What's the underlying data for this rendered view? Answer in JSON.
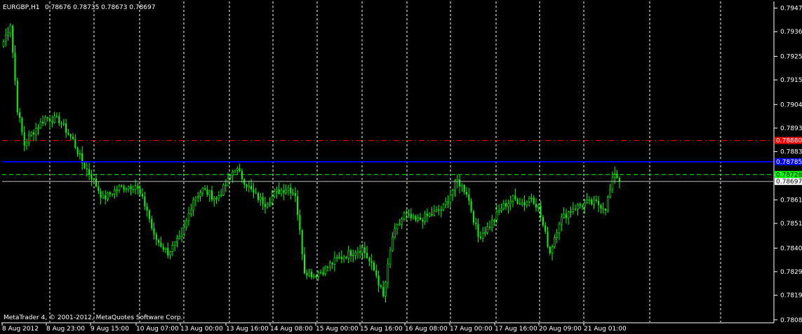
{
  "window": {
    "title": "EURGBP,H1",
    "ohlc": "0.78676 0.78735 0.78673 0.78697",
    "copyright": "MetaTrader 4, © 2001-2012, MetaQuotes Software Corp."
  },
  "colors": {
    "background": "#000000",
    "bull": "#00ff00",
    "bear": "#00ff00",
    "grid": "#ffffff",
    "axis_text": "#ffffff",
    "red_line": "#ff0000",
    "blue_line": "#0000ff",
    "green_line": "#00ff00",
    "price_line": "#c0c0c0"
  },
  "chart_data": {
    "type": "candlestick",
    "symbol": "EURGBP",
    "timeframe": "H1",
    "ylim": [
      0.7807,
      0.795
    ],
    "y_ticks": [
      "0.79470",
      "0.79365",
      "0.79255",
      "0.79150",
      "0.79040",
      "0.78935",
      "0.78830",
      "0.78725",
      "0.78615",
      "0.78510",
      "0.78400",
      "0.78295",
      "0.78190",
      "0.78080"
    ],
    "x_ticks": [
      "8 Aug 2012",
      "8 Aug 23:00",
      "9 Aug 15:00",
      "10 Aug 07:00",
      "13 Aug 00:00",
      "13 Aug 16:00",
      "14 Aug 08:00",
      "15 Aug 00:00",
      "15 Aug 16:00",
      "16 Aug 08:00",
      "17 Aug 00:00",
      "17 Aug 16:00",
      "20 Aug 09:00",
      "21 Aug 01:00"
    ],
    "grid": true,
    "horizontal_lines": [
      {
        "name": "red-level-line",
        "value": 0.7888,
        "style": "dash-dot",
        "color": "#ff0000",
        "label": "0.78880"
      },
      {
        "name": "blue-level-line",
        "value": 0.78785,
        "style": "solid",
        "color": "#0000ff",
        "label": "0.78785"
      },
      {
        "name": "green-level-line",
        "value": 0.78728,
        "style": "dashed",
        "color": "#00ff00",
        "label": "0.78728"
      },
      {
        "name": "current-price-line",
        "value": 0.78697,
        "style": "solid",
        "color": "#c0c0c0",
        "label": "0.78697"
      }
    ],
    "close_anchors": [
      {
        "bar": 0,
        "close": 0.7932
      },
      {
        "bar": 3,
        "close": 0.794
      },
      {
        "bar": 6,
        "close": 0.7902
      },
      {
        "bar": 9,
        "close": 0.7886
      },
      {
        "bar": 12,
        "close": 0.7891
      },
      {
        "bar": 18,
        "close": 0.7898
      },
      {
        "bar": 24,
        "close": 0.7897
      },
      {
        "bar": 30,
        "close": 0.7888
      },
      {
        "bar": 34,
        "close": 0.7878
      },
      {
        "bar": 38,
        "close": 0.7872
      },
      {
        "bar": 43,
        "close": 0.7862
      },
      {
        "bar": 50,
        "close": 0.7867
      },
      {
        "bar": 57,
        "close": 0.7868
      },
      {
        "bar": 62,
        "close": 0.7857
      },
      {
        "bar": 65,
        "close": 0.7845
      },
      {
        "bar": 71,
        "close": 0.7838
      },
      {
        "bar": 77,
        "close": 0.7845
      },
      {
        "bar": 82,
        "close": 0.7862
      },
      {
        "bar": 86,
        "close": 0.7866
      },
      {
        "bar": 92,
        "close": 0.7862
      },
      {
        "bar": 96,
        "close": 0.7868
      },
      {
        "bar": 100,
        "close": 0.7876
      },
      {
        "bar": 104,
        "close": 0.787
      },
      {
        "bar": 108,
        "close": 0.7864
      },
      {
        "bar": 113,
        "close": 0.786
      },
      {
        "bar": 118,
        "close": 0.7865
      },
      {
        "bar": 123,
        "close": 0.7867
      },
      {
        "bar": 126,
        "close": 0.7864
      },
      {
        "bar": 130,
        "close": 0.783
      },
      {
        "bar": 134,
        "close": 0.7828
      },
      {
        "bar": 138,
        "close": 0.783
      },
      {
        "bar": 144,
        "close": 0.7835
      },
      {
        "bar": 150,
        "close": 0.7838
      },
      {
        "bar": 155,
        "close": 0.784
      },
      {
        "bar": 161,
        "close": 0.7828
      },
      {
        "bar": 164,
        "close": 0.7818
      },
      {
        "bar": 168,
        "close": 0.7845
      },
      {
        "bar": 173,
        "close": 0.7855
      },
      {
        "bar": 178,
        "close": 0.7852
      },
      {
        "bar": 185,
        "close": 0.7855
      },
      {
        "bar": 190,
        "close": 0.7858
      },
      {
        "bar": 196,
        "close": 0.787
      },
      {
        "bar": 200,
        "close": 0.7865
      },
      {
        "bar": 205,
        "close": 0.7845
      },
      {
        "bar": 210,
        "close": 0.785
      },
      {
        "bar": 215,
        "close": 0.7858
      },
      {
        "bar": 220,
        "close": 0.7862
      },
      {
        "bar": 225,
        "close": 0.786
      },
      {
        "bar": 228,
        "close": 0.7863
      },
      {
        "bar": 231,
        "close": 0.7858
      },
      {
        "bar": 236,
        "close": 0.7838
      },
      {
        "bar": 240,
        "close": 0.7852
      },
      {
        "bar": 246,
        "close": 0.7858
      },
      {
        "bar": 252,
        "close": 0.786
      },
      {
        "bar": 256,
        "close": 0.786
      },
      {
        "bar": 260,
        "close": 0.7858
      },
      {
        "bar": 262,
        "close": 0.7866
      },
      {
        "bar": 264,
        "close": 0.7874
      },
      {
        "bar": 266,
        "close": 0.78697
      }
    ]
  }
}
